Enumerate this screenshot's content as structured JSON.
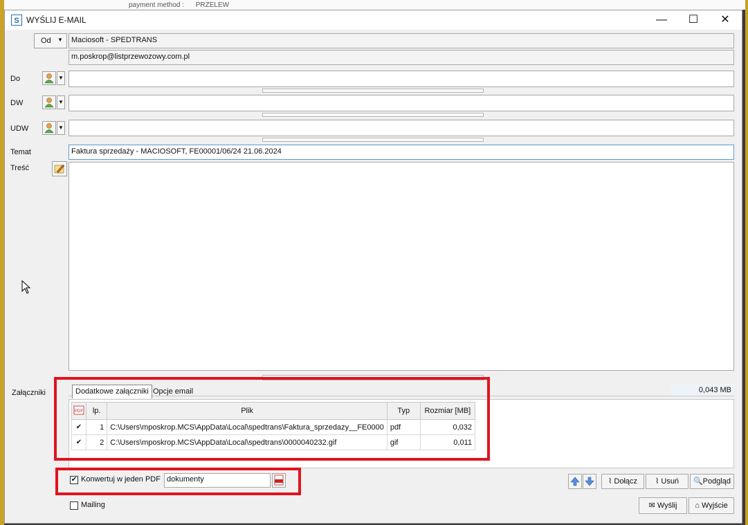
{
  "background": {
    "text": "payment method :      PRZELEW"
  },
  "window": {
    "title": "WYŚLIJ E-MAIL",
    "app_icon": "S",
    "controls": {
      "minimize": "—",
      "maximize": "☐",
      "close": "✕"
    }
  },
  "from": {
    "button_label": "Od",
    "name": "Maciosoft - SPEDTRANS",
    "email": "m.poskrop@listprzewozowy.com.pl"
  },
  "recipients": {
    "to_label": "Do",
    "cc_label": "DW",
    "bcc_label": "UDW",
    "to_value": "",
    "cc_value": "",
    "bcc_value": ""
  },
  "subject": {
    "label": "Temat",
    "value": "Faktura sprzedaży - MACIOSOFT, FE00001/06/24 21.06.2024"
  },
  "body": {
    "label": "Treść",
    "value": ""
  },
  "attachments": {
    "label": "Załączniki",
    "total_size": "0,043 MB",
    "tabs": [
      "Dodatkowe załączniki",
      "Opcje email"
    ],
    "columns": {
      "lp": "lp.",
      "file": "Plik",
      "type": "Typ",
      "size": "Rozmiar [MB]"
    },
    "rows": [
      {
        "checked": "✔",
        "lp": "1",
        "file": "C:\\Users\\mposkrop.MCS\\AppData\\Local\\spedtrans\\Faktura_sprzedazy__FE0000",
        "type": "pdf",
        "size": "0,032"
      },
      {
        "checked": "✔",
        "lp": "2",
        "file": "C:\\Users\\mposkrop.MCS\\AppData\\Local\\spedtrans\\0000040232.gif",
        "type": "gif",
        "size": "0,011"
      }
    ]
  },
  "pdf_option": {
    "checkbox_label": "Konwertuj w jeden PDF",
    "checked": "✔",
    "filename": "dokumenty"
  },
  "mailing": {
    "checkbox_label": "Mailing"
  },
  "buttons": {
    "attach": "Dołącz",
    "remove": "Usuń",
    "preview": "Podgląd",
    "send": "Wyślij",
    "exit": "Wyjście"
  },
  "colors": {
    "highlight_red": "#e0141e",
    "accent_blue": "#2a6db5"
  }
}
